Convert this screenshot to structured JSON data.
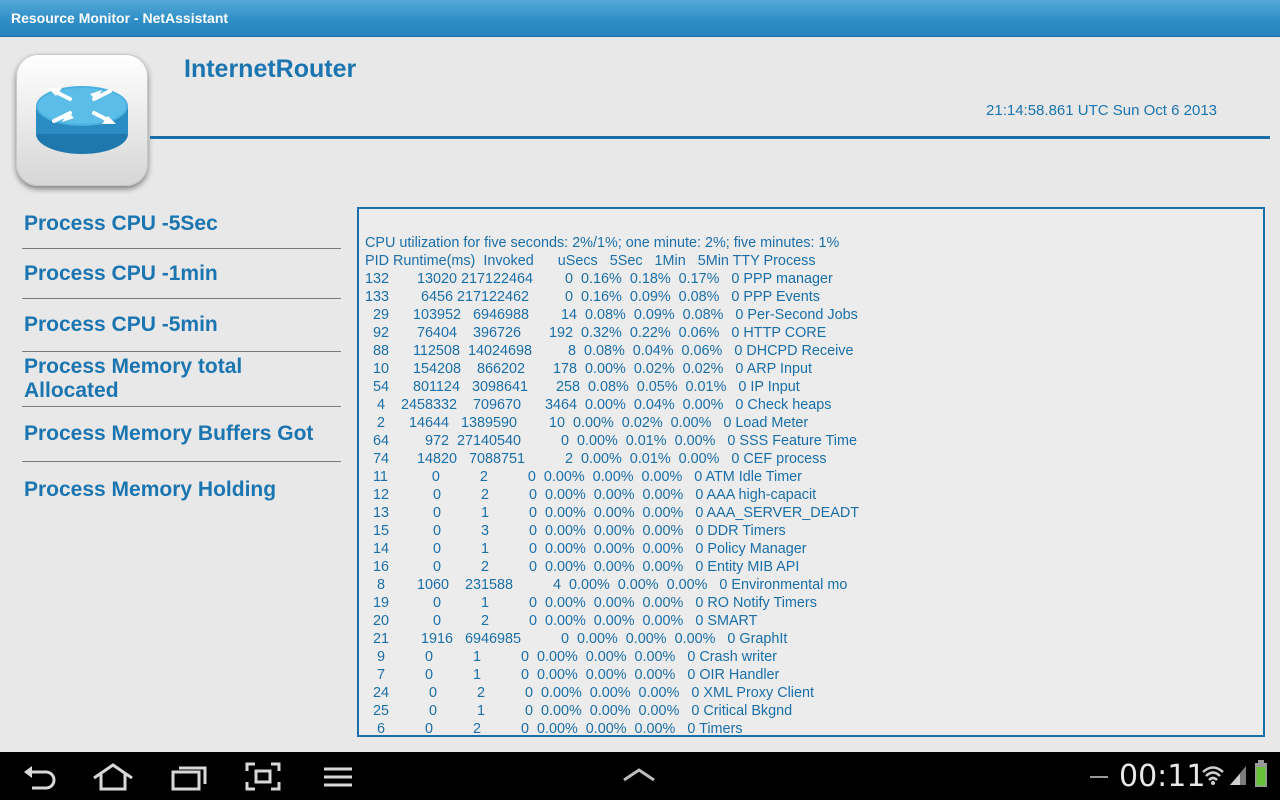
{
  "app": {
    "title": "Resource Monitor - NetAssistant"
  },
  "header": {
    "device_name": "InternetRouter",
    "timestamp": "21:14:58.861 UTC Sun Oct 6 2013",
    "logo_icon": "router-icon",
    "accent_color": "#1b75b0"
  },
  "menu": {
    "items": [
      {
        "label": "Process CPU -5Sec"
      },
      {
        "label": "Process CPU -1min"
      },
      {
        "label": "Process CPU -5min"
      },
      {
        "label": "Process Memory total Allocated"
      },
      {
        "label": "Process Memory Buffers Got"
      },
      {
        "label": "Process Memory Holding"
      }
    ]
  },
  "output": {
    "text": "CPU utilization for five seconds: 2%/1%; one minute: 2%; five minutes: 1%\nPID Runtime(ms)  Invoked      uSecs   5Sec   1Min   5Min TTY Process\n132       13020 217122464        0  0.16%  0.18%  0.17%   0 PPP manager\n133        6456 217122462         0  0.16%  0.09%  0.08%   0 PPP Events\n  29      103952   6946988        14  0.08%  0.09%  0.08%   0 Per-Second Jobs\n  92       76404    396726       192  0.32%  0.22%  0.06%   0 HTTP CORE\n  88      112508  14024698         8  0.08%  0.04%  0.06%   0 DHCPD Receive\n  10      154208    866202       178  0.00%  0.02%  0.02%   0 ARP Input\n  54      801124   3098641       258  0.08%  0.05%  0.01%   0 IP Input\n   4    2458332    709670      3464  0.00%  0.04%  0.00%   0 Check heaps\n   2      14644   1389590        10  0.00%  0.02%  0.00%   0 Load Meter\n  64         972  27140540          0  0.00%  0.01%  0.00%   0 SSS Feature Time\n  74       14820   7088751          2  0.00%  0.01%  0.00%   0 CEF process\n  11           0          2          0  0.00%  0.00%  0.00%   0 ATM Idle Timer\n  12           0          2          0  0.00%  0.00%  0.00%   0 AAA high-capacit\n  13           0          1          0  0.00%  0.00%  0.00%   0 AAA_SERVER_DEADT\n  15           0          3          0  0.00%  0.00%  0.00%   0 DDR Timers\n  14           0          1          0  0.00%  0.00%  0.00%   0 Policy Manager\n  16           0          2          0  0.00%  0.00%  0.00%   0 Entity MIB API\n   8        1060    231588          4  0.00%  0.00%  0.00%   0 Environmental mo\n  19           0          1          0  0.00%  0.00%  0.00%   0 RO Notify Timers\n  20           0          2          0  0.00%  0.00%  0.00%   0 SMART\n  21        1916   6946985          0  0.00%  0.00%  0.00%   0 GraphIt\n   9          0          1          0  0.00%  0.00%  0.00%   0 Crash writer\n   7          0          1          0  0.00%  0.00%  0.00%   0 OIR Handler\n  24          0          2          0  0.00%  0.00%  0.00%   0 XML Proxy Client\n  25          0          1          0  0.00%  0.00%  0.00%   0 Critical Bkgnd\n   6          0          2          0  0.00%  0.00%  0.00%   0 Timers"
  },
  "system_bar": {
    "clock": "00:11",
    "buttons": [
      "back-icon",
      "home-icon",
      "recent-apps-icon",
      "screenshot-icon",
      "menu-icon"
    ],
    "center_button": "chevron-up-icon",
    "status_icons": [
      "wifi-icon",
      "signal-icon",
      "battery-icon"
    ]
  }
}
